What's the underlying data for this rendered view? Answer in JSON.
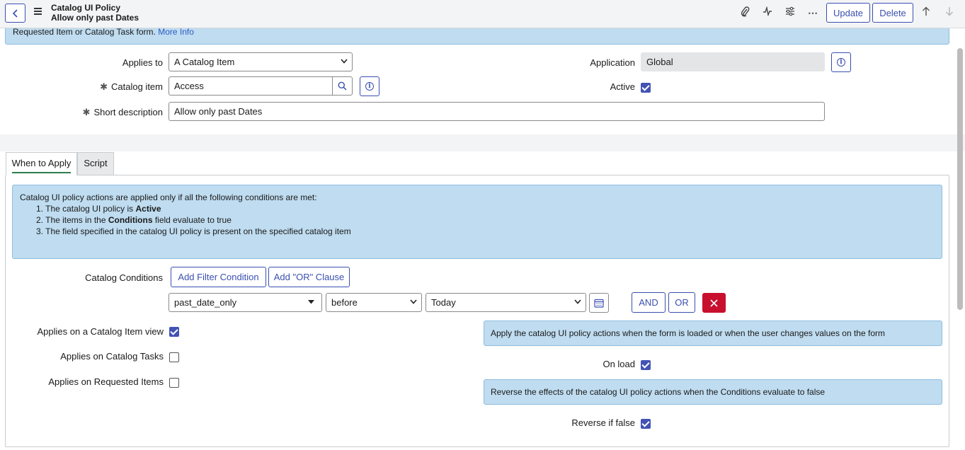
{
  "header": {
    "title": "Catalog UI Policy",
    "subtitle": "Allow only past Dates",
    "update_label": "Update",
    "delete_label": "Delete"
  },
  "banner_top": {
    "text": "Requested Item or Catalog Task form.",
    "link": "More Info"
  },
  "form": {
    "applies_to": {
      "label": "Applies to",
      "value": "A Catalog Item"
    },
    "catalog_item": {
      "label": "Catalog item",
      "value": "Access"
    },
    "short_description": {
      "label": "Short description",
      "value": "Allow only past Dates"
    },
    "application": {
      "label": "Application",
      "value": "Global"
    },
    "active": {
      "label": "Active",
      "checked": true
    }
  },
  "tabs": [
    {
      "label": "When to Apply",
      "active": true
    },
    {
      "label": "Script",
      "active": false
    }
  ],
  "conditions_info": {
    "intro": "Catalog UI policy actions are applied only if all the following conditions are met:",
    "item1_pre": "1. The catalog UI policy is ",
    "item1_bold": "Active",
    "item2_pre": "2. The items in the ",
    "item2_bold": "Conditions",
    "item2_post": " field evaluate to true",
    "item3": "3. The field specified in the catalog UI policy is present on the specified catalog item"
  },
  "catalog_conditions": {
    "label": "Catalog Conditions",
    "add_filter_label": "Add Filter Condition",
    "add_or_label": "Add \"OR\" Clause",
    "field_value": "past_date_only",
    "operator_value": "before",
    "date_value": "Today",
    "and_label": "AND",
    "or_label": "OR"
  },
  "applies": {
    "item_view": {
      "label": "Applies on a Catalog Item view",
      "checked": true
    },
    "tasks": {
      "label": "Applies on Catalog Tasks",
      "checked": false
    },
    "requested": {
      "label": "Applies on Requested Items",
      "checked": false
    }
  },
  "onload_info": "Apply the catalog UI policy actions when the form is loaded or when the user changes values on the form",
  "onload": {
    "label": "On load",
    "checked": true
  },
  "reverse_info": "Reverse the effects of the catalog UI policy actions when the Conditions evaluate to false",
  "reverse": {
    "label": "Reverse if false",
    "checked": true
  },
  "colors": {
    "accent": "#3a4fb0",
    "banner": "#bfdcf0",
    "delete_red": "#c8102e",
    "checkbox": "#4253b4"
  }
}
